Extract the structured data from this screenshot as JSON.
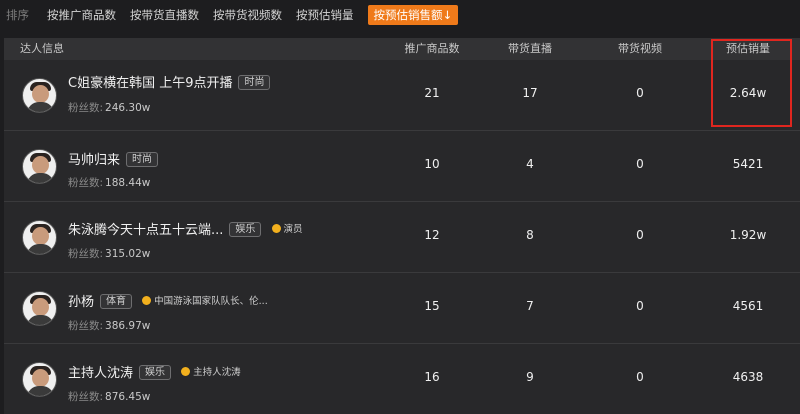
{
  "sort": {
    "label": "排序",
    "options": [
      "按推广商品数",
      "按带货直播数",
      "按带货视频数",
      "按预估销量"
    ],
    "active": "按预估销售额↓"
  },
  "table": {
    "headers": [
      "达人信息",
      "推广商品数",
      "带货直播",
      "带货视频",
      "预估销量"
    ],
    "fans_label": "粉丝数:",
    "rows": [
      {
        "name": "C姐豪横在韩国 上午9点开播",
        "tag": "时尚",
        "badge": "",
        "fans": "246.30w",
        "products": "21",
        "lives": "17",
        "videos": "0",
        "sales": "2.64w"
      },
      {
        "name": "马帅归来",
        "tag": "时尚",
        "badge": "",
        "fans": "188.44w",
        "products": "10",
        "lives": "4",
        "videos": "0",
        "sales": "5421"
      },
      {
        "name": "朱泳腾今天十点五十云端...",
        "tag": "娱乐",
        "badge": "演员",
        "fans": "315.02w",
        "products": "12",
        "lives": "8",
        "videos": "0",
        "sales": "1.92w"
      },
      {
        "name": "孙杨",
        "tag": "体育",
        "badge": "中国游泳国家队队长、伦...",
        "fans": "386.97w",
        "products": "15",
        "lives": "7",
        "videos": "0",
        "sales": "4561"
      },
      {
        "name": "主持人沈涛",
        "tag": "娱乐",
        "badge": "主持人沈涛",
        "fans": "876.45w",
        "products": "16",
        "lives": "9",
        "videos": "0",
        "sales": "4638"
      }
    ]
  },
  "colors": {
    "accent": "#ef7a1a",
    "highlight": "#e0261f",
    "badge_dot": "#f2b01e"
  }
}
